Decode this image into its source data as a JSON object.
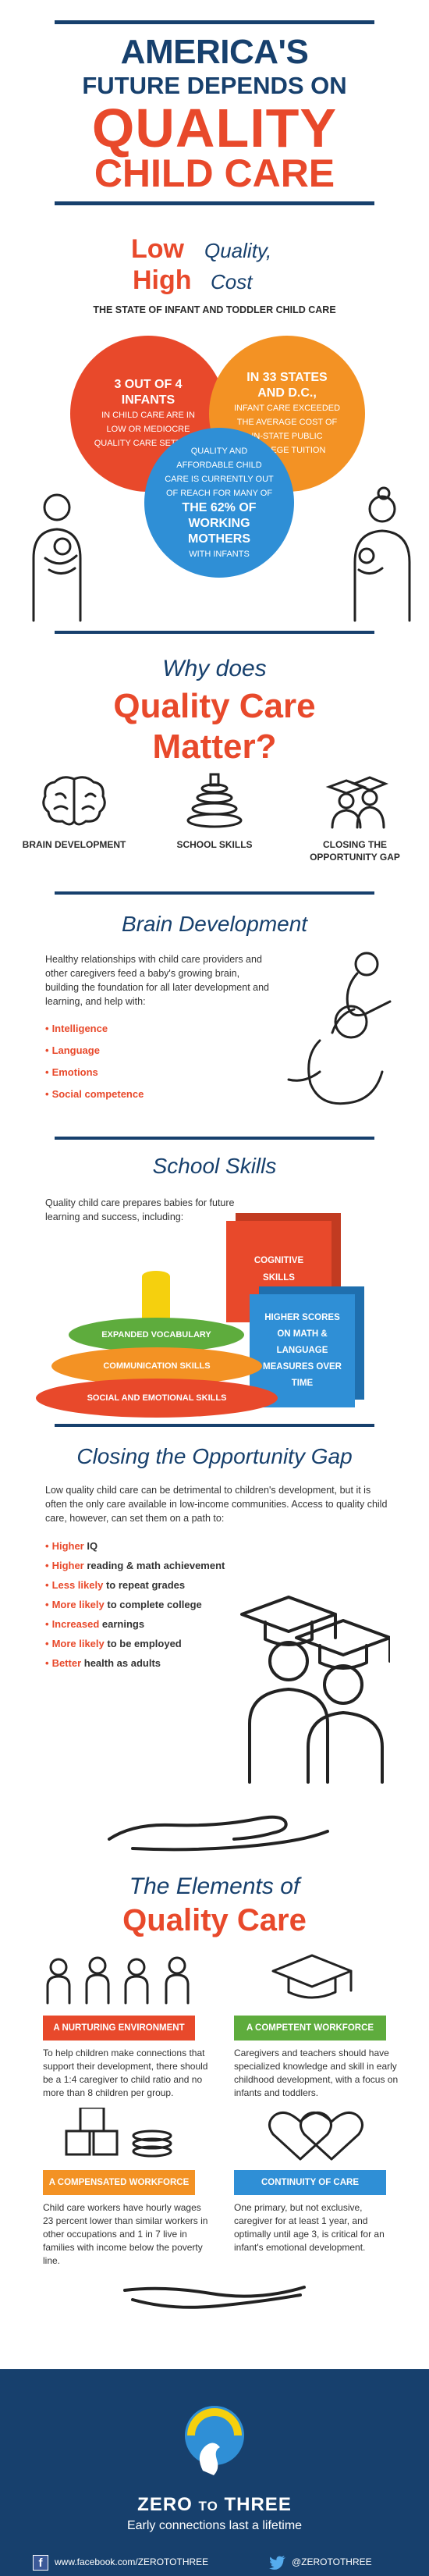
{
  "header": {
    "line1": "AMERICA'S",
    "line2": "FUTURE DEPENDS ON",
    "line3": "QUALITY",
    "line4": "CHILD CARE"
  },
  "cost": {
    "title_low": "Low",
    "title_quality": "Quality,",
    "title_high": "High",
    "title_cost": "Cost",
    "subtitle": "THE STATE OF INFANT AND TODDLER CHILD CARE",
    "stat1_big": "3 out of 4 infants",
    "stat1_small": "in child care are in low or mediocre quality care settings",
    "stat2_big": "In 33 states and D.C.,",
    "stat2_small": "infant care exceeded the average cost of in-state public college tuition",
    "stat3_small": "Quality and affordable child care is currently out of reach for many of",
    "stat3_big": "the 62% of working mothers",
    "stat3_tail": "with infants"
  },
  "why": {
    "line1": "Why does",
    "line2": "Quality Care",
    "line3": "Matter?",
    "icons": [
      {
        "icon": "brain-icon",
        "label": "BRAIN DEVELOPMENT"
      },
      {
        "icon": "stacking-rings-icon",
        "label": "SCHOOL SKILLS"
      },
      {
        "icon": "graduates-icon",
        "label": "CLOSING THE OPPORTUNITY GAP"
      }
    ]
  },
  "brain": {
    "title": "Brain Development",
    "text": "Healthy relationships with child care providers and other caregivers feed a baby's growing brain, building the foundation for all later development and learning, and help with:",
    "items": [
      "Intelligence",
      "Language",
      "Emotions",
      "Social competence"
    ]
  },
  "school": {
    "title": "School Skills",
    "text": "Quality child care prepares babies for future learning and success, including:",
    "box_red": "COGNITIVE SKILLS",
    "box_blue": "HIGHER SCORES ON MATH & LANGUAGE MEASURES OVER TIME",
    "ring_green": "EXPANDED VOCABULARY",
    "ring_orange": "COMMUNICATION SKILLS",
    "ring_red": "SOCIAL AND EMOTIONAL SKILLS"
  },
  "gap": {
    "title": "Closing the Opportunity Gap",
    "text": "Low quality child care can be detrimental to children's development, but it is often the only care available in low-income communities. Access to quality child care, however, can set them on a path to:",
    "items": [
      {
        "em": "Higher",
        "rest": "IQ"
      },
      {
        "em": "Higher",
        "rest": "reading & math achievement"
      },
      {
        "em": "Less likely",
        "rest": "to repeat grades"
      },
      {
        "em": "More likely",
        "rest": "to complete college"
      },
      {
        "em": "Increased",
        "rest": "earnings"
      },
      {
        "em": "More likely",
        "rest": "to be employed"
      },
      {
        "em": "Better",
        "rest": "health as adults"
      }
    ]
  },
  "elements": {
    "line1": "The Elements of",
    "line2": "Quality Care",
    "e1_tag": "A NURTURING ENVIRONMENT",
    "e1_text": "To help children make connections that support their development, there should be a 1:4 caregiver to child ratio and no more than 8 children per group.",
    "e2_tag": "A COMPETENT WORKFORCE",
    "e2_text": "Caregivers and teachers should have specialized knowledge and skill in early childhood development, with a focus on infants and toddlers.",
    "e3_tag": "A COMPENSATED WORKFORCE",
    "e3_text": "Child care workers have hourly wages 23 percent lower than similar workers in other occupations and 1 in 7 live in families with income below the poverty line.",
    "e4_tag": "CONTINUITY OF CARE",
    "e4_text": "One primary, but not exclusive, caregiver for at least 1 year, and optimally until age 3, is critical for an infant's emotional development."
  },
  "footer": {
    "name_a": "ZERO",
    "name_b": "TO",
    "name_c": "THREE",
    "tagline": "Early connections last a lifetime",
    "facebook": "www.facebook.com/ZEROTOTHREE",
    "twitter": "@ZEROTOTHREE"
  },
  "colors": {
    "navy": "#17406d",
    "red": "#e8492b",
    "orange": "#f39224",
    "blue": "#2f8fd6",
    "green": "#5eac3d",
    "yellow": "#f5d00e"
  }
}
